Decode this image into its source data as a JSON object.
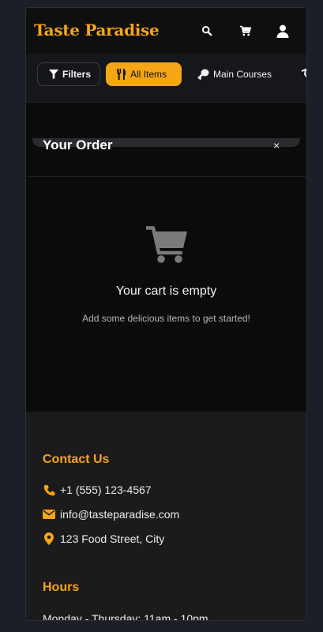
{
  "brand": {
    "name": "Taste Paradise"
  },
  "categories": {
    "filters_label": "Filters",
    "items": [
      {
        "label": "All Items",
        "active": true
      },
      {
        "label": "Main Courses",
        "active": false
      }
    ]
  },
  "order": {
    "title": "Your Order",
    "close_symbol": "×",
    "empty_title": "Your cart is empty",
    "empty_subtitle": "Add some delicious items to get started!"
  },
  "contact": {
    "title": "Contact Us",
    "phone": "+1 (555) 123-4567",
    "email": "info@tasteparadise.com",
    "address": "123 Food Street, City"
  },
  "hours": {
    "title": "Hours",
    "weekday": "Monday - Thursday: 11am - 10pm"
  },
  "icons": [
    "search-icon",
    "cart-icon",
    "user-icon",
    "filter-icon",
    "utensils-icon",
    "drumstick-icon",
    "close-icon",
    "phone-icon",
    "envelope-icon",
    "map-pin-icon"
  ],
  "colors": {
    "accent": "#f5a516",
    "background": "#0b0b0b",
    "footer": "#1b1b1d"
  }
}
